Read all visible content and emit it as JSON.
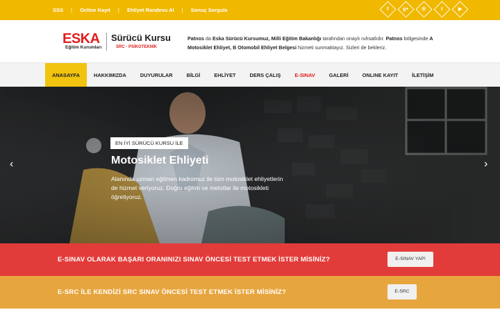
{
  "topbar": {
    "links": [
      "SSS",
      "Online Kayıt",
      "Ehliyet Randevu Al",
      "Sonuç Sorgula"
    ],
    "separator": "|",
    "social_icons": [
      {
        "name": "facebook-icon",
        "glyph": "f"
      },
      {
        "name": "google-plus-icon",
        "glyph": "g+"
      },
      {
        "name": "instagram-icon",
        "glyph": "◎"
      },
      {
        "name": "twitter-icon",
        "glyph": "t"
      },
      {
        "name": "youtube-icon",
        "glyph": "▶"
      }
    ]
  },
  "logo": {
    "brand": "ESKA",
    "brand_sub": "Eğitim Kurumları",
    "name": "Sürücü Kursu",
    "tagline": "SRC - PSİKOTEKNİK"
  },
  "header_info": {
    "p1": "Patnos",
    "p2": " da ",
    "p3": "Eska Sürücü Kursumuz, Milli Eğitim Bakanlığı",
    "p4": " tarafından onaylı ruhsatlıdır. ",
    "p5": "Patnos",
    "p6": " bölgesinde ",
    "p7": "A Motosiklet Ehliyet, B Otomobil Ehliyet Belgesi",
    "p8": " hizmeti sunmaktayız. Sizleri de bekleriz."
  },
  "nav": {
    "items": [
      {
        "label": "ANASAYFA",
        "state": "active"
      },
      {
        "label": "HAKKIMIZDA",
        "state": ""
      },
      {
        "label": "DUYURULAR",
        "state": ""
      },
      {
        "label": "BİLGİ",
        "state": ""
      },
      {
        "label": "EHLİYET",
        "state": ""
      },
      {
        "label": "DERS ÇALIŞ",
        "state": ""
      },
      {
        "label": "E-SINAV",
        "state": "red"
      },
      {
        "label": "GALERİ",
        "state": ""
      },
      {
        "label": "ONLINE KAYIT",
        "state": ""
      },
      {
        "label": "İLETİŞİM",
        "state": ""
      }
    ]
  },
  "hero": {
    "tag": "EN İYİ SÜRÜCÜ KURSU İLE",
    "title": "Motosiklet Ehliyeti",
    "description": "Alanında uzman eğitmen kadromuz ile tüm motosiklet ehliyetlerin de hizmet veriyoruz. Doğru eğitim ve metotlar ile motosikleti öğretiyoruz.",
    "prev_arrow": "‹",
    "next_arrow": "›"
  },
  "cta1": {
    "text": "E-SINAV OLARAK BAŞARI ORANINIZI SINAV ÖNCESİ TEST ETMEK İSTER MİSİNİZ?",
    "button": "E-SINAV YAP!"
  },
  "cta2": {
    "text": "E-SRC İLE KENDİZİ SRC SINAV ÖNCESİ TEST ETMEK İSTER MİSİNİZ?",
    "button": "E-SRC"
  },
  "colors": {
    "topbar": "#f1b800",
    "accent_red": "#e11d1d",
    "nav_active": "#f1c40f",
    "cta1_bg": "#e23c3a",
    "cta2_bg": "#e7a53e"
  }
}
